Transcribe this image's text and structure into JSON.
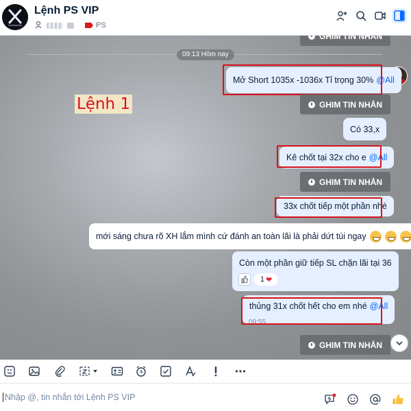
{
  "header": {
    "title": "Lệnh PS VIP",
    "tag_label": "PS"
  },
  "chat": {
    "time_separator": "09:13 Hôm nay",
    "annotation": "Lệnh 1",
    "pin_label": "GHIM TIN NHẮN",
    "messages": [
      {
        "text": "Mở Short 1035x -1036x Tỉ trọng 30%",
        "mention": "@All"
      },
      {
        "text": "Có 33,x"
      },
      {
        "text": "Kê chốt tại 32x cho e",
        "mention": "@All"
      },
      {
        "text": "33x chốt tiếp một phần nhé"
      },
      {
        "text": "mới sáng chưa rõ XH lắm mình cứ đánh an toàn lãi là phải dứt túi ngay"
      },
      {
        "text": "Còn một phần giữ tiếp SL chặn lãi tại 36",
        "reaction_count": "1"
      },
      {
        "text": "thủng 31x chốt hết cho em nhé",
        "mention": "@All",
        "time": "09:55"
      }
    ]
  },
  "composer": {
    "placeholder": "Nhập @, tin nhắn tới Lệnh PS VIP"
  },
  "colors": {
    "accent": "#0068ff",
    "highlight_box": "#d8111b",
    "bubble_mine": "#e5efff"
  }
}
